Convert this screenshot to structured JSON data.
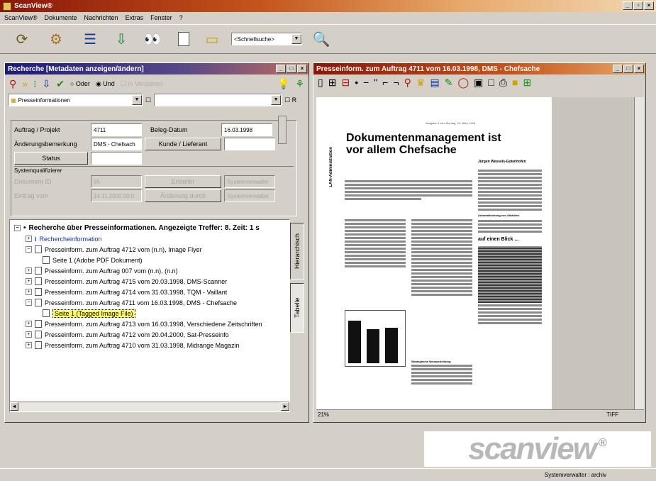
{
  "app": {
    "title": "ScanView®"
  },
  "menu": [
    "ScanView®",
    "Dokumente",
    "Nachrichten",
    "Extras",
    "Fenster",
    "?"
  ],
  "toolbar": {
    "search_placeholder": "<Schnellsuche>"
  },
  "left_panel": {
    "title": "Recherche [Metadaten anzeigen/ändern]",
    "radio_oder": "Oder",
    "radio_und": "Und",
    "checkbox_versionen": "in Versionen",
    "combo_value": "Presseinformationen",
    "r_label": "R",
    "form": {
      "auftrag_label": "Auftrag / Projekt",
      "auftrag_value": "4711",
      "beleg_label": "Beleg-Datum",
      "beleg_value": "16.03.1998",
      "aenderung_label": "Änderungsbemerkung",
      "aenderung_value": "DMS - Chefsach",
      "kunde_button": "Kunde / Lieferant",
      "status_button": "Status",
      "systemqualifizierer": "Systemqualifizierer",
      "dokument_id_label": "Dokument ID",
      "dokument_id_value": "35",
      "ersteller_button": "Ersteller",
      "systemverwalter1": "Systemverwalter",
      "eintrag_label": "Eintrag vom",
      "eintrag_value": "14.11.2000 00:0",
      "aenderung_durch_button": "Änderung durch",
      "systemverwalter2": "Systemverwalter"
    },
    "tree": {
      "root": "Recherche über Presseinformationen. Angezeigte Treffer: 8. Zeit: 1 s",
      "items": [
        "Rechercheinformation",
        "Presseinform. zum Auftrag 4712 vom (n.n), Image Flyer",
        "Seite 1 (Adobe PDF Dokument)",
        "Presseinform. zum Auftrag 007 vom (n.n), (n.n)",
        "Presseinform. zum Auftrag 4715 vom 20.03.1998, DMS-Scanner",
        "Presseinform. zum Auftrag 4714 vom 31.03.1998, TQM - Vaillant",
        "Presseinform. zum Auftrag 4711 vom 16.03.1998, DMS - Chefsache",
        "Seite 1 (Tagged Image File)",
        "Presseinform. zum Auftrag 4713 vom 16.03.1998, Verschiedene Zeitschriften",
        "Presseinform. zum Auftrag 4712 vom 20.04.2000, Sat-Presseinfo",
        "Presseinform. zum Auftrag 4710 vom 31.03.1998, Midrange Magazin"
      ]
    },
    "tabs": {
      "hierarchisch": "Hierarchisch",
      "tabelle": "Tabelle"
    }
  },
  "right_panel": {
    "title": "Presseinform. zum Auftrag 4711 vom 16.03.1998, DMS - Chefsache",
    "doc_date": "Ausgabe 5 vom Montag, 16. März 1998",
    "doc_heading": "Dokumentenmanagement ist vor allem Chefsache",
    "doc_section": "LAN-Administration",
    "doc_author": "Jürgen Wessels-Gutenhofen",
    "doc_subhead1": "Automatisierung von Abläufen",
    "doc_subhead2": "auf einen Blick ...",
    "doc_subhead3": "Strategische Neuausrichtung",
    "zoom": "21%",
    "format": "TIFF"
  },
  "logo": {
    "text": "scanview",
    "reg": "®"
  },
  "status": {
    "user": "Systemverwalter : archiv"
  }
}
